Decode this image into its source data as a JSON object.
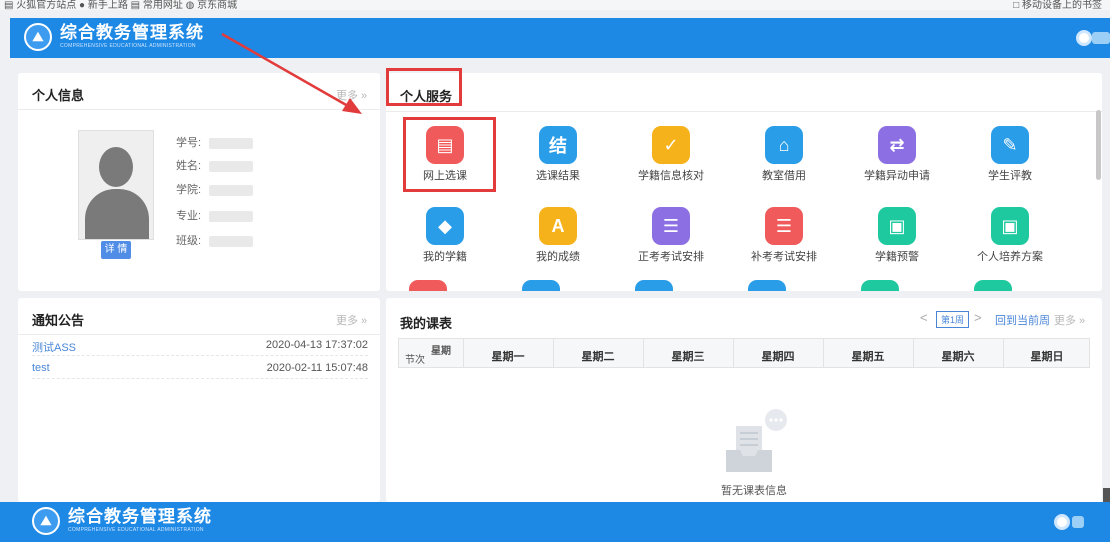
{
  "bookmarks": {
    "left": "▤ 火狐官方站点  ● 新手上路  ▤ 常用网址  ◍ 京东商城",
    "right": "□ 移动设备上的书签"
  },
  "header": {
    "title": "综合教务管理系统",
    "subtitle": "COMPREHENSIVE EDUCATIONAL ADMINISTRATION"
  },
  "personal_info": {
    "title": "个人信息",
    "more": "更多 »",
    "detail_button": "详 情",
    "fields": [
      {
        "label": "学号:"
      },
      {
        "label": "姓名:"
      },
      {
        "label": "学院:"
      },
      {
        "label": "专业:"
      },
      {
        "label": "班级:"
      }
    ]
  },
  "services": {
    "title": "个人服务",
    "items": [
      {
        "label": "网上选课",
        "icon": "course-select-icon",
        "color": "#f05a5a",
        "glyph": "▤"
      },
      {
        "label": "选课结果",
        "icon": "course-result-icon",
        "color": "#2a9de8",
        "glyph": "结"
      },
      {
        "label": "学籍信息核对",
        "icon": "status-check-icon",
        "color": "#f6b21a",
        "glyph": "✓"
      },
      {
        "label": "教室借用",
        "icon": "classroom-icon",
        "color": "#2a9de8",
        "glyph": "⌂"
      },
      {
        "label": "学籍异动申请",
        "icon": "status-change-icon",
        "color": "#8c6fe3",
        "glyph": "⇄"
      },
      {
        "label": "学生评教",
        "icon": "evaluation-icon",
        "color": "#2a9de8",
        "glyph": "✎"
      },
      {
        "label": "我的学籍",
        "icon": "graduation-cap-icon",
        "color": "#2a9de8",
        "glyph": "◆"
      },
      {
        "label": "我的成绩",
        "icon": "grades-icon",
        "color": "#f6b21a",
        "glyph": "A"
      },
      {
        "label": "正考考试安排",
        "icon": "exam-schedule-icon",
        "color": "#8c6fe3",
        "glyph": "☰"
      },
      {
        "label": "补考考试安排",
        "icon": "makeup-exam-icon",
        "color": "#f05a5a",
        "glyph": "☰"
      },
      {
        "label": "学籍预警",
        "icon": "status-warning-icon",
        "color": "#1fc9a0",
        "glyph": "▣"
      },
      {
        "label": "个人培养方案",
        "icon": "training-plan-icon",
        "color": "#1fc9a0",
        "glyph": "▣"
      }
    ],
    "partial_row_colors": [
      "#f05a5a",
      "#2a9de8",
      "#2a9de8",
      "#2a9de8",
      "#1fc9a0",
      "#1fc9a0"
    ]
  },
  "notices": {
    "title": "通知公告",
    "more": "更多 »",
    "items": [
      {
        "title": "测试ASS",
        "date": "2020-04-13 17:37:02"
      },
      {
        "title": "test",
        "date": "2020-02-11 15:07:48"
      }
    ]
  },
  "schedule": {
    "title": "我的课表",
    "prev": "<",
    "week": "第1周",
    "next": ">",
    "current_week": "回到当前周",
    "more": "更多 »",
    "corner_session": "节次",
    "corner_weekday": "星期",
    "days": [
      "星期一",
      "星期二",
      "星期三",
      "星期四",
      "星期五",
      "星期六",
      "星期日"
    ],
    "empty_text": "暂无课表信息"
  },
  "colors": {
    "header_blue": "#1e88e5",
    "annotation_red": "#e23b3b",
    "link_blue": "#4a86d8"
  }
}
